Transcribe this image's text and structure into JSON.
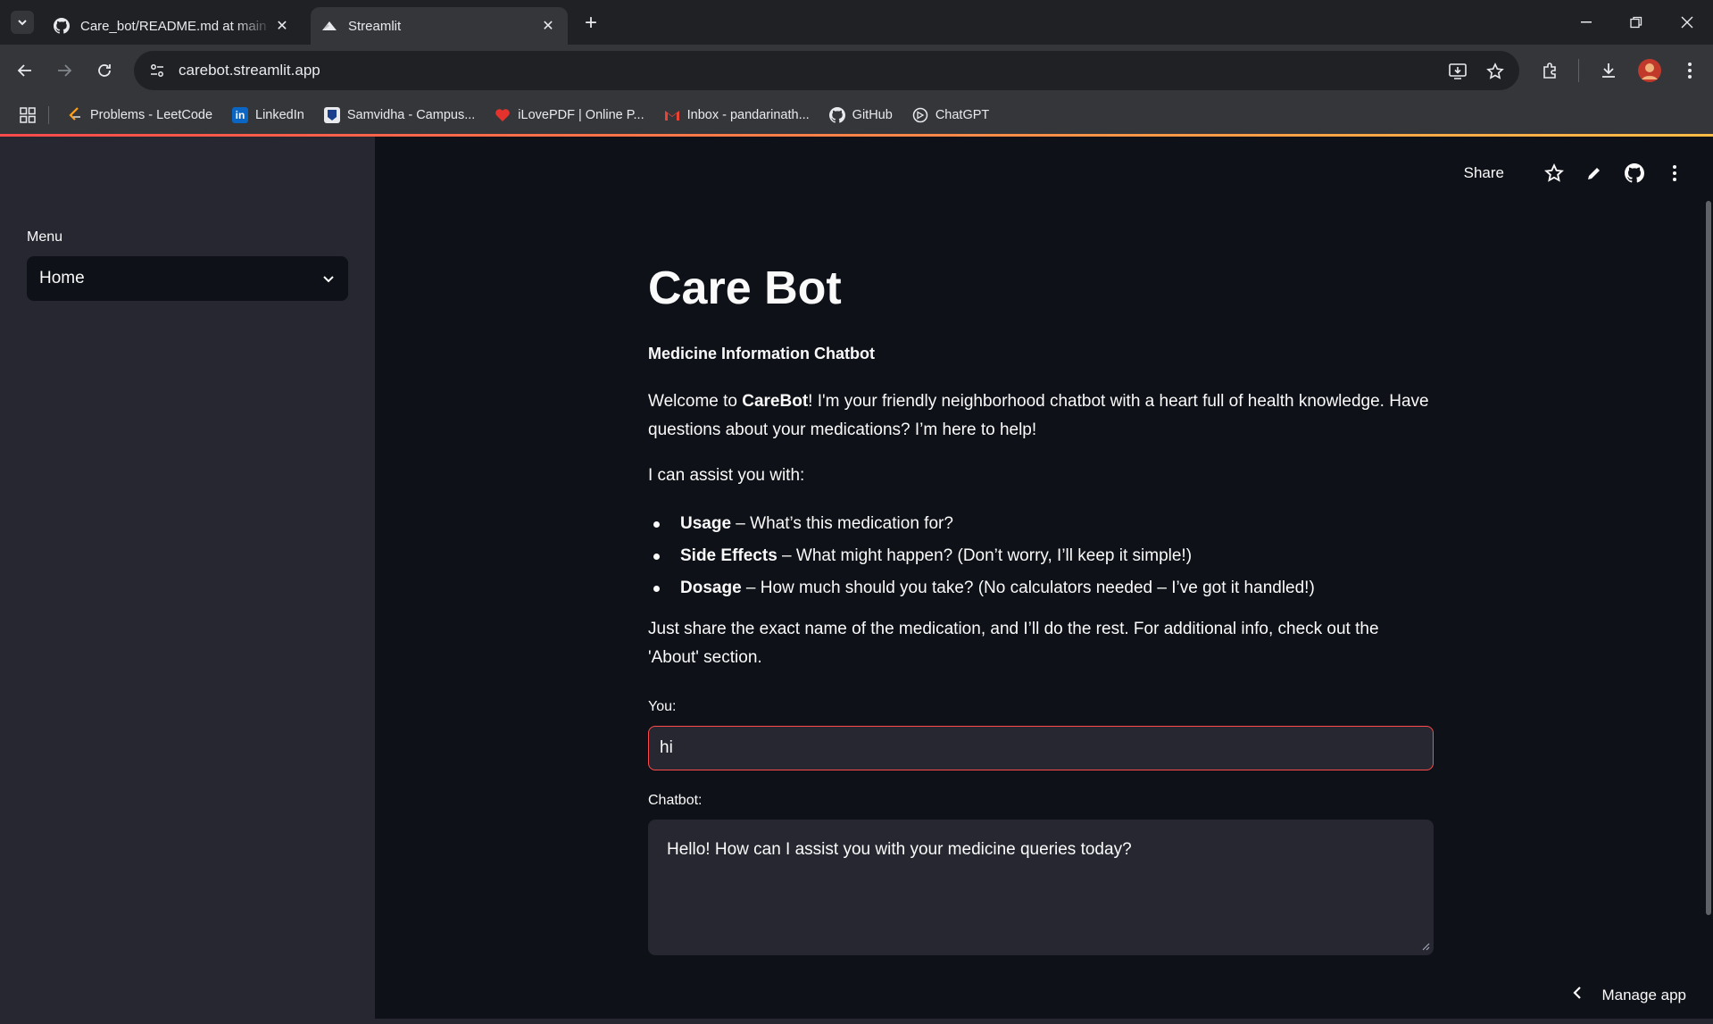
{
  "browser": {
    "tabs": [
      {
        "title": "Care_bot/README.md at main · ",
        "icon": "github-icon",
        "active": false
      },
      {
        "title": "Streamlit",
        "icon": "streamlit-icon",
        "active": true
      }
    ],
    "url": "carebot.streamlit.app",
    "bookmarks": [
      {
        "label": "Problems - LeetCode",
        "icon": "leetcode-icon"
      },
      {
        "label": "LinkedIn",
        "icon": "linkedin-icon"
      },
      {
        "label": "Samvidha - Campus...",
        "icon": "samvidha-icon"
      },
      {
        "label": "iLovePDF | Online P...",
        "icon": "ilovepdf-icon"
      },
      {
        "label": "Inbox - pandarinath...",
        "icon": "gmail-icon"
      },
      {
        "label": "GitHub",
        "icon": "github-icon"
      },
      {
        "label": "ChatGPT",
        "icon": "chatgpt-icon"
      }
    ]
  },
  "sidebar": {
    "menu_label": "Menu",
    "selected": "Home"
  },
  "header": {
    "share_label": "Share"
  },
  "main": {
    "title": "Care Bot",
    "subtitle": "Medicine Information Chatbot",
    "welcome_prefix": "Welcome to ",
    "welcome_bold": "CareBot",
    "welcome_suffix": "! I'm your friendly neighborhood chatbot with a heart full of health knowledge. Have questions about your medications? I’m here to help!",
    "assist_intro": "I can assist you with:",
    "features": [
      {
        "name": "Usage",
        "desc": " – What’s this medication for?"
      },
      {
        "name": "Side Effects",
        "desc": " – What might happen? (Don’t worry, I’ll keep it simple!)"
      },
      {
        "name": "Dosage",
        "desc": " – How much should you take? (No calculators needed – I’ve got it handled!)"
      }
    ],
    "closing": "Just share the exact name of the medication, and I’ll do the rest. For additional info, check out the 'About' section.",
    "you_label": "You:",
    "you_value": "hi",
    "chatbot_label": "Chatbot:",
    "chatbot_value": "Hello! How can I assist you with your medicine queries today?"
  },
  "footer": {
    "manage_app": "Manage app"
  },
  "colors": {
    "accent": "#ff4b4b",
    "background": "#0e1117",
    "sidebar": "#262730"
  }
}
